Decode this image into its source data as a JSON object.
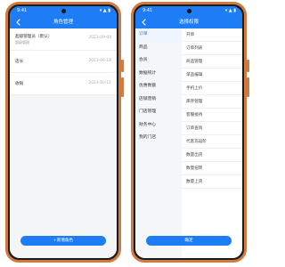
{
  "colors": {
    "primary": "#1e7cf5",
    "frame": "#cf7a3e"
  },
  "status_bar": {
    "time": "9:41",
    "icons": "▾ ▲ ▮"
  },
  "left_screen": {
    "title": "角色管理",
    "back_icon": "back-chevron-icon",
    "roles": [
      {
        "name": "超级管理员（默认）",
        "sub": "超级管理",
        "date": "2023-09-04"
      },
      {
        "name": "店长",
        "sub": "",
        "date": "2023-09-18"
      },
      {
        "name": "收银",
        "sub": "",
        "date": "2023-10-11"
      }
    ],
    "add_button": "+新增角色"
  },
  "right_screen": {
    "title": "选择权限",
    "back_icon": "back-chevron-icon",
    "categories": [
      "订单",
      "商品",
      "会员",
      "数据统计",
      "优惠数额",
      "店铺营销",
      "门店管理",
      "财务中心",
      "我的门店"
    ],
    "permissions": [
      "开单",
      "订单列表",
      "商品管理",
      "单品编辑",
      "手机上价",
      "库存管理",
      "客服接待",
      "订单查询",
      "代客充返阶",
      "数量出货",
      "数量扭转",
      "数量上货"
    ],
    "confirm_button": "确定"
  }
}
